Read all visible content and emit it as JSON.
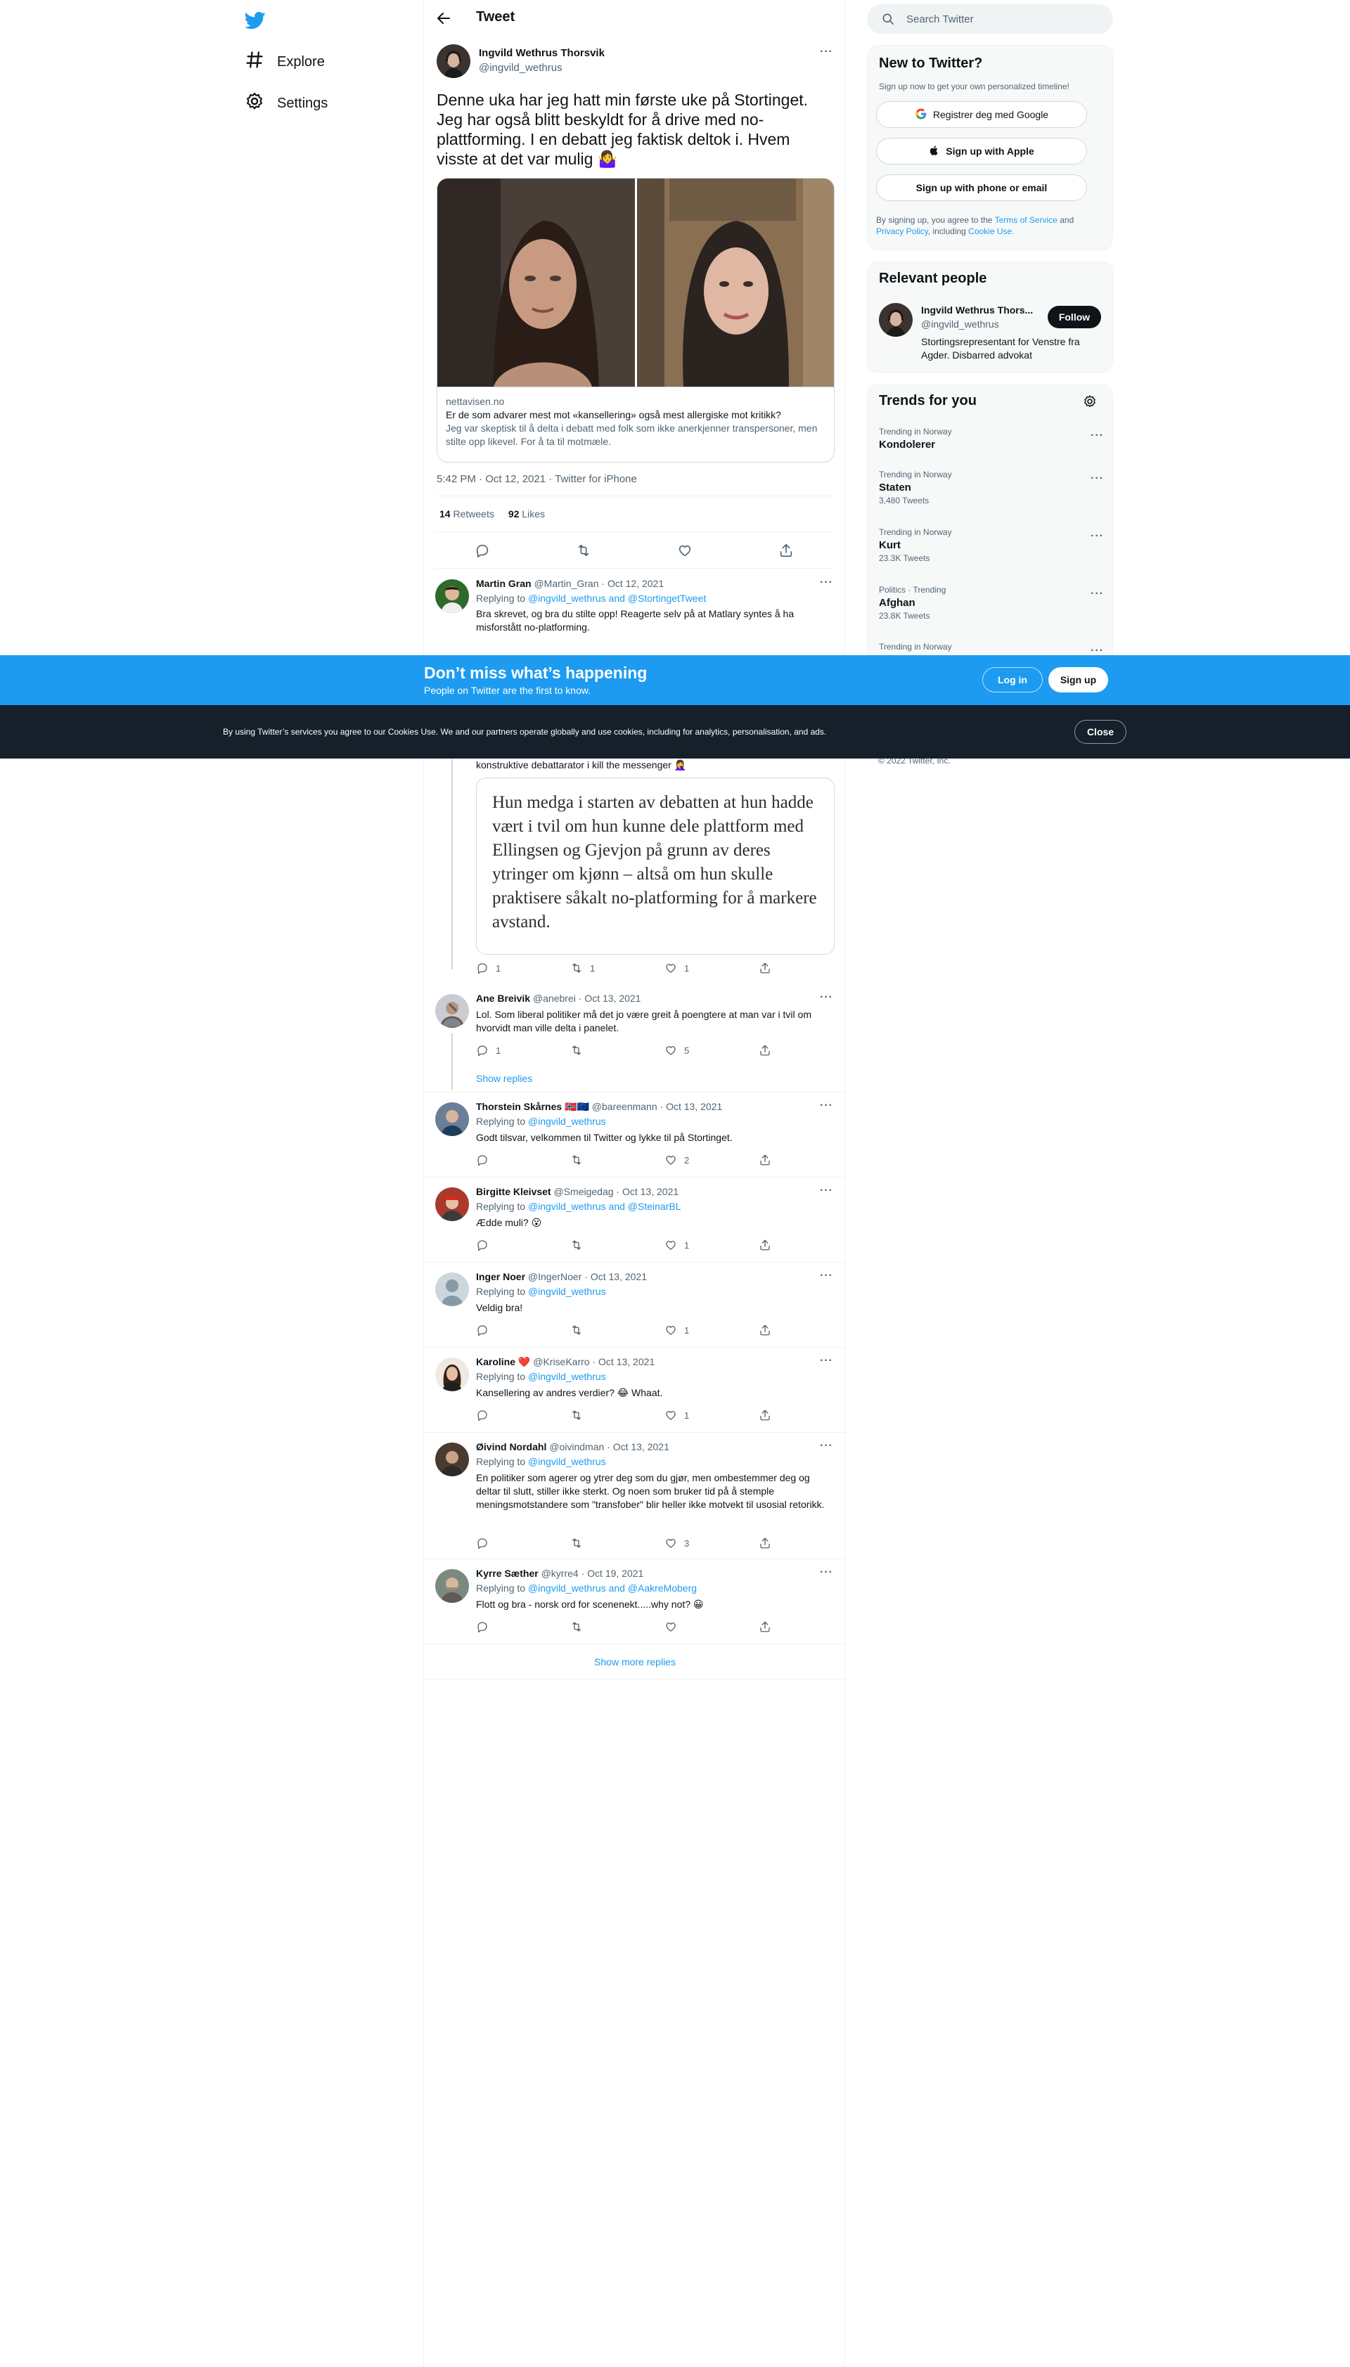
{
  "nav": {
    "explore": "Explore",
    "settings": "Settings"
  },
  "header": {
    "title": "Tweet"
  },
  "tweet": {
    "author_name": "Ingvild Wethrus Thorsvik",
    "author_handle": "@ingvild_wethrus",
    "text": "Denne uka har jeg hatt min første uke på Stortinget. Jeg har også blitt beskyldt for å drive med no-plattforming. I en debatt jeg faktisk deltok i. Hvem visste at det var mulig 🤷‍♀️",
    "card_domain": "nettavisen.no",
    "card_title": "Er de som advarer mest mot «kansellering» også mest allergiske mot kritikk?",
    "card_desc": "Jeg var skeptisk til å delta i debatt med folk som ikke anerkjenner transpersoner, men stilte opp likevel. For å ta til motmæle.",
    "timestamp": "5:42 PM · Oct 12, 2021 · Twitter for iPhone",
    "retweets_count": "14",
    "retweets_label": "Retweets",
    "likes_count": "92",
    "likes_label": "Likes"
  },
  "replies": [
    {
      "name": "Martin Gran",
      "handle": "@Martin_Gran",
      "date": "· Oct 12, 2021",
      "replying_prefix": "Replying to ",
      "replying_to": "@ingvild_wethrus and @StortingetTweet",
      "text": "Bra skrevet, og bra du stilte opp! Reagerte selv på at Matlary syntes å ha misforstått no-platforming.",
      "reply_count": "",
      "retweet_count": "",
      "like_count": ""
    },
    {
      "partial_text": "konstruktive debattarator i kill the messenger 🤦‍♀️",
      "quote": "Hun medga i starten av debatten at hun hadde vært i tvil om hun kunne dele plattform med Ellingsen og Gjevjon på grunn av deres ytringer om kjønn – altså om hun skulle praktisere såkalt no-platforming for å markere avstand.",
      "reply_count": "1",
      "retweet_count": "1",
      "like_count": "1"
    },
    {
      "name": "Ane Breivik",
      "handle": "@anebrei",
      "date": "· Oct 13, 2021",
      "text": "Lol. Som liberal politiker må det jo være greit å poengtere at man var i tvil om hvorvidt man ville delta i panelet.",
      "reply_count": "1",
      "retweet_count": "",
      "like_count": "5",
      "show_replies": "Show replies"
    },
    {
      "name": "Thorstein Skårnes 🇳🇴🇪🇺",
      "handle": "@bareenmann",
      "date": "· Oct 13, 2021",
      "replying_prefix": "Replying to ",
      "replying_to": "@ingvild_wethrus",
      "text": "Godt tilsvar, velkommen til Twitter og lykke til på Stortinget.",
      "reply_count": "",
      "retweet_count": "",
      "like_count": "2"
    },
    {
      "name": "Birgitte Kleivset",
      "handle": "@Smeigedag",
      "date": "· Oct 13, 2021",
      "replying_prefix": "Replying to ",
      "replying_to": "@ingvild_wethrus and @SteinarBL",
      "text": "Ædde muli? 😮",
      "reply_count": "",
      "retweet_count": "",
      "like_count": "1"
    },
    {
      "name": "Inger Noer",
      "handle": "@IngerNoer",
      "date": "· Oct 13, 2021",
      "replying_prefix": "Replying to ",
      "replying_to": "@ingvild_wethrus",
      "text": "Veldig bra!",
      "reply_count": "",
      "retweet_count": "",
      "like_count": "1"
    },
    {
      "name": "Karoline ❤️",
      "handle": "@KriseKarro",
      "date": "· Oct 13, 2021",
      "replying_prefix": "Replying to ",
      "replying_to": "@ingvild_wethrus",
      "text": "Kansellering av andres verdier? 😂 Whaat.",
      "reply_count": "",
      "retweet_count": "",
      "like_count": "1"
    },
    {
      "name": "Øivind Nordahl",
      "handle": "@oivindman",
      "date": "· Oct 13, 2021",
      "replying_prefix": "Replying to ",
      "replying_to": "@ingvild_wethrus",
      "text": "En politiker som agerer og ytrer deg som du gjør, men ombestemmer deg og deltar til slutt, stiller ikke sterkt. Og noen som bruker tid på å stemple meningsmotstandere som \"transfober\" blir heller ikke motvekt til usosial retorikk.",
      "reply_count": "",
      "retweet_count": "",
      "like_count": "3"
    },
    {
      "name": "Kyrre Sæther",
      "handle": "@kyrre4",
      "date": "· Oct 19, 2021",
      "replying_prefix": "Replying to ",
      "replying_to": "@ingvild_wethrus and @AakreMoberg",
      "text": "Flott og bra - norsk ord for scenenekt.....why not? 😀",
      "reply_count": "",
      "retweet_count": "",
      "like_count": ""
    }
  ],
  "show_more_replies": "Show more replies",
  "search": {
    "placeholder": "Search Twitter"
  },
  "new_to_twitter": {
    "title": "New to Twitter?",
    "subtitle": "Sign up now to get your own personalized timeline!",
    "google": "Registrer deg med Google",
    "apple": "Sign up with Apple",
    "phone": "Sign up with phone or email",
    "terms_1": "By signing up, you agree to the ",
    "terms_link": "Terms of Service",
    "terms_2": " and ",
    "privacy_link": "Privacy Policy",
    "terms_3": ", including ",
    "cookie_link": "Cookie Use."
  },
  "relevant_people": {
    "title": "Relevant people",
    "name": "Ingvild Wethrus Thors...",
    "handle": "@ingvild_wethrus",
    "follow": "Follow",
    "bio": "Stortingsrepresentant for Venstre fra Agder. Disbarred advokat"
  },
  "trends": {
    "title": "Trends for you",
    "items": [
      {
        "category": "Trending in Norway",
        "topic": "Kondolerer",
        "count": ""
      },
      {
        "category": "Trending in Norway",
        "topic": "Staten",
        "count": "3,480 Tweets"
      },
      {
        "category": "Trending in Norway",
        "topic": "Kurt",
        "count": "23.3K Tweets"
      },
      {
        "category": "Politics · Trending",
        "topic": "Afghan",
        "count": "23.8K Tweets"
      },
      {
        "category": "Trending in Norway",
        "topic": "",
        "count": ""
      }
    ]
  },
  "footer_copyright": "© 2022 Twitter, Inc.",
  "signup_bar": {
    "title": "Don’t miss what’s happening",
    "subtitle": "People on Twitter are the first to know.",
    "login": "Log in",
    "signup": "Sign up"
  },
  "cookie_bar": {
    "text": "By using Twitter’s services you agree to our Cookies Use. We and our partners operate globally and use cookies, including for analytics, personalisation, and ads.",
    "close": "Close"
  },
  "colors": {
    "accent": "#1d9bf0",
    "dark": "#0f1419",
    "muted": "#536471",
    "cookie_bg": "#15202b"
  }
}
